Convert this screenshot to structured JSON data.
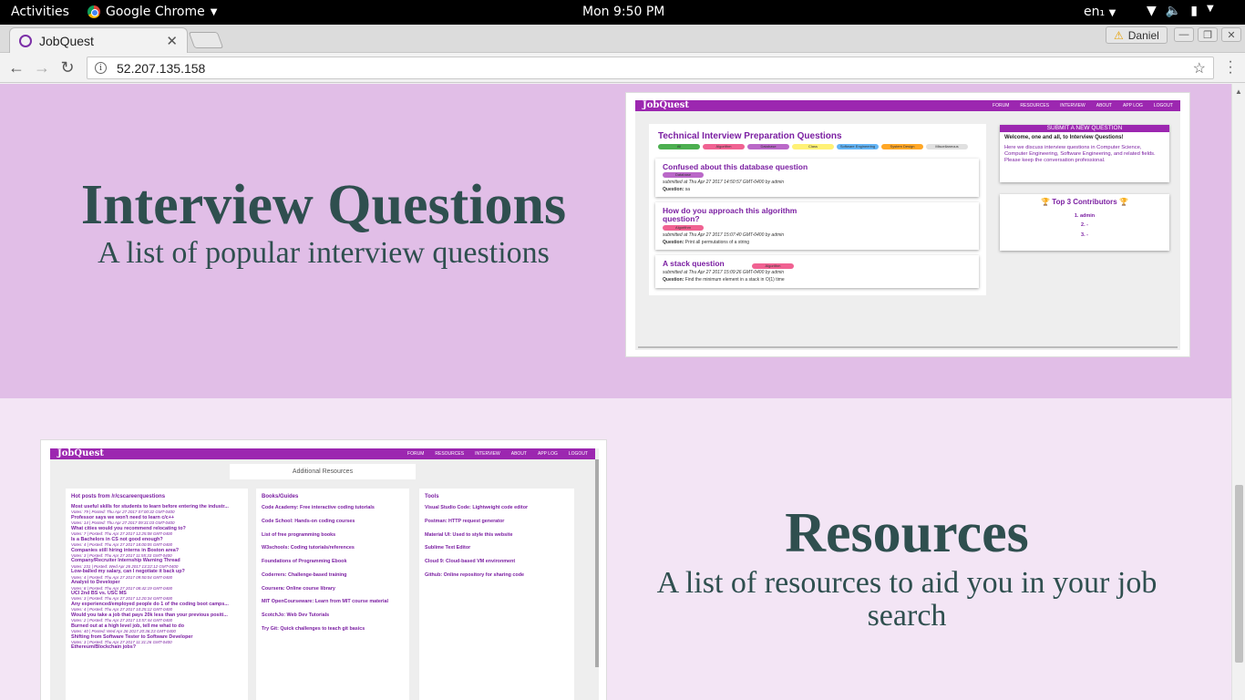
{
  "os_bar": {
    "activities": "Activities",
    "app_name": "Google Chrome",
    "clock": "Mon  9:50 PM",
    "language": "en₁"
  },
  "browser": {
    "tab_title": "JobQuest",
    "profile_name": "Daniel",
    "url": "52.207.135.158"
  },
  "page": {
    "interview": {
      "title": "Interview Questions",
      "subtitle": "A list of popular interview questions"
    },
    "resources": {
      "title": "Resources",
      "subtitle": "A list of resources to aid you in your job search"
    }
  },
  "shot_interview": {
    "logo": "JobQuest",
    "nav": [
      "FORUM",
      "RESOURCES",
      "INTERVIEW",
      "ABOUT",
      "APP LOG",
      "LOGOUT"
    ],
    "heading": "Technical Interview Preparation Questions",
    "filters": [
      {
        "label": "All",
        "color": "#4caf50"
      },
      {
        "label": "Algorithm",
        "color": "#f06292"
      },
      {
        "label": "Database",
        "color": "#ba68c8"
      },
      {
        "label": "Class",
        "color": "#fff176"
      },
      {
        "label": "Software Engineering",
        "color": "#64b5f6"
      },
      {
        "label": "System Design",
        "color": "#ffa726"
      },
      {
        "label": "Miscellaneous",
        "color": "#e0e0e0"
      }
    ],
    "questions": [
      {
        "title": "Confused about this database question",
        "tag": "Database",
        "tag_color": "#ba68c8",
        "meta": "submitted at Thu Apr 27 2017 14:50:57 GMT-0400 by admin",
        "question_label": "Question:",
        "question": "sa"
      },
      {
        "title": "How do you approach this algorithm question?",
        "tag": "Algorithm",
        "tag_color": "#f06292",
        "meta": "submitted at Thu Apr 27 2017 15:07:40 GMT-0400 by admin",
        "question_label": "Question:",
        "question": "Print all permutations of a string"
      },
      {
        "title": "A stack question",
        "tag": "Algorithm",
        "tag_color": "#f06292",
        "meta": "submitted at Thu Apr 27 2017 15:09:26 GMT-0400 by admin",
        "question_label": "Question:",
        "question": "Find the minimum element in a stack in O(1) time"
      }
    ],
    "submit_button": "SUBMIT A NEW QUESTION",
    "welcome_title": "Welcome, one and all, to Interview Questions!",
    "welcome_text": "Here we discuss interview questions in Computer Science, Computer Engineering, Software Engineering, and related fields. Please keep the conversation professional.",
    "contributors_title": "Top 3 Contributors",
    "contributors": [
      "1. admin",
      "2. -",
      "3. -"
    ]
  },
  "shot_resources": {
    "logo": "JobQuest",
    "nav": [
      "FORUM",
      "RESOURCES",
      "INTERVIEW",
      "ABOUT",
      "APP LOG",
      "LOGOUT"
    ],
    "header": "Additional Resources",
    "hot_title": "Hot posts from /r/cscareerquestions",
    "hot_posts": [
      {
        "title": "Most useful skills for students to learn before entering the industr...",
        "meta": "Votes: 79 | Posted: Thu Apr 27 2017 07:00:32 GMT-0400"
      },
      {
        "title": "Professor says we won't need to learn c/c++",
        "meta": "Votes: 14 | Posted: Thu Apr 27 2017 09:31:03 GMT-0400"
      },
      {
        "title": "What cities would you recommend relocating to?",
        "meta": "Votes: 7 | Posted: Thu Apr 27 2017 12:25:08 GMT-0400"
      },
      {
        "title": "Is a Bachelors in CS not good enough?",
        "meta": "Votes: 4 | Posted: Thu Apr 27 2017 18:00:05 GMT-0400"
      },
      {
        "title": "Companies still hiring interns in Boston area?",
        "meta": "Votes: 3 | Posted: Thu Apr 27 2017 11:55:33 GMT-0400"
      },
      {
        "title": "Company/Recruiter Internship Warning Thread",
        "meta": "Votes: 231 | Posted: Wed Apr 26 2017 13:22:12 GMT-0400"
      },
      {
        "title": "Low-balled my salary, can I negotiate it back up?",
        "meta": "Votes: 4 | Posted: Thu Apr 27 2017 09:50:04 GMT-0400"
      },
      {
        "title": "Analyst to Developer",
        "meta": "Votes: 8 | Posted: Thu Apr 27 2017 08:42:19 GMT-0400"
      },
      {
        "title": "UCI 2nd BS vs. USC MS",
        "meta": "Votes: 3 | Posted: Thu Apr 27 2017 12:20:34 GMT-0400"
      },
      {
        "title": "Any experienced/employed people do 1 of the coding boot camps...",
        "meta": "Votes: 4 | Posted: Thu Apr 27 2017 10:25:12 GMT-0400"
      },
      {
        "title": "Would you take a job that pays 20k less than your previous positi...",
        "meta": "Votes: 2 | Posted: Thu Apr 27 2017 13:57:44 GMT-0400"
      },
      {
        "title": "Burned out at a high level job, tell me what to do",
        "meta": "Votes: 40 | Posted: Wed Apr 26 2017 20:36:23 GMT-0400"
      },
      {
        "title": "Shifting from Software Tester to Software Developer",
        "meta": "Votes: 3 | Posted: Thu Apr 27 2017 11:31:26 GMT-0400"
      },
      {
        "title": "Ethereum/Blockchain jobs?",
        "meta": ""
      }
    ],
    "books_title": "Books/Guides",
    "books": [
      "Code Academy: Free interactive coding tutorials",
      "Code School: Hands-on coding courses",
      "List of free programming books",
      "W3schools: Coding tutorials/references",
      "Foundations of Programming Ebook",
      "Coderrers: Challenge-based training",
      "Coursera: Online course library",
      "MIT OpenCourseware: Learn from MIT course material",
      "ScotchJo: Web Dev Tutorials",
      "Try Git: Quick challenges to teach git basics"
    ],
    "tools_title": "Tools",
    "tools": [
      "Visual Studio Code: Lightweight code editor",
      "Postman: HTTP request generator",
      "Material UI: Used to style this website",
      "Sublime Text Editor",
      "Cloud 9: Cloud-based VM environment",
      "Github: Online repository for sharing code"
    ]
  }
}
